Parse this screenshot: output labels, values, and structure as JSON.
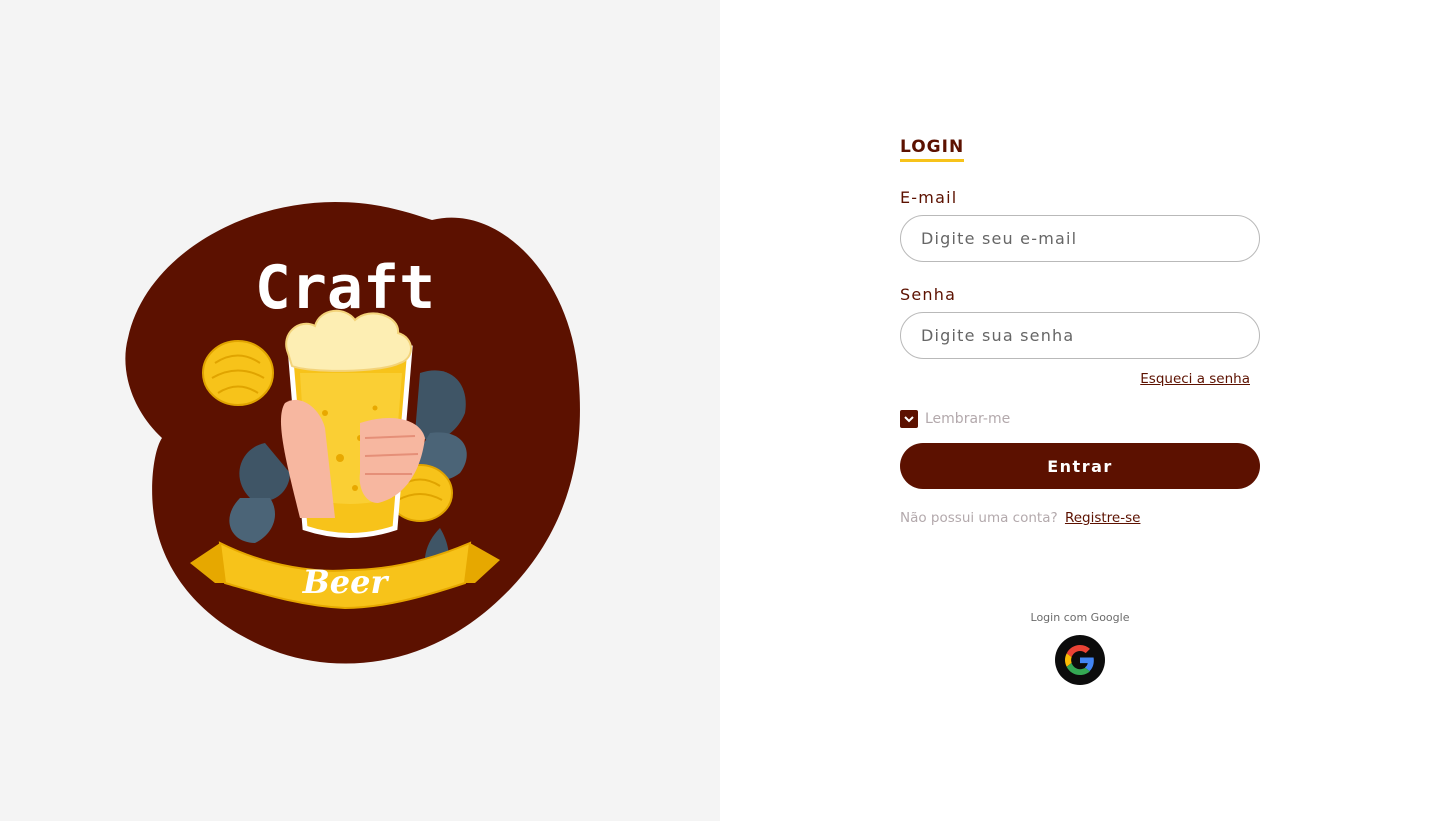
{
  "brand": {
    "logo_text_top": "Craft",
    "logo_text_bottom": "Beer",
    "logo_bg_color": "#5c1100",
    "logo_accent_color": "#f7c31a"
  },
  "login": {
    "title": "LOGIN",
    "email_label": "E-mail",
    "email_placeholder": "Digite seu e-mail",
    "password_label": "Senha",
    "password_placeholder": "Digite sua senha",
    "forgot_password": "Esqueci a senha",
    "remember_me": "Lembrar-me",
    "remember_checked": true,
    "submit_label": "Entrar",
    "no_account_text": "Não possui uma conta?",
    "register_link": "Registre-se",
    "google_label": "Login com Google",
    "google_icon": "google-g-icon"
  },
  "colors": {
    "primary": "#5c1100",
    "accent": "#f7c31a",
    "left_panel_bg": "#f4f4f4",
    "muted_text": "#b3a9ac"
  }
}
